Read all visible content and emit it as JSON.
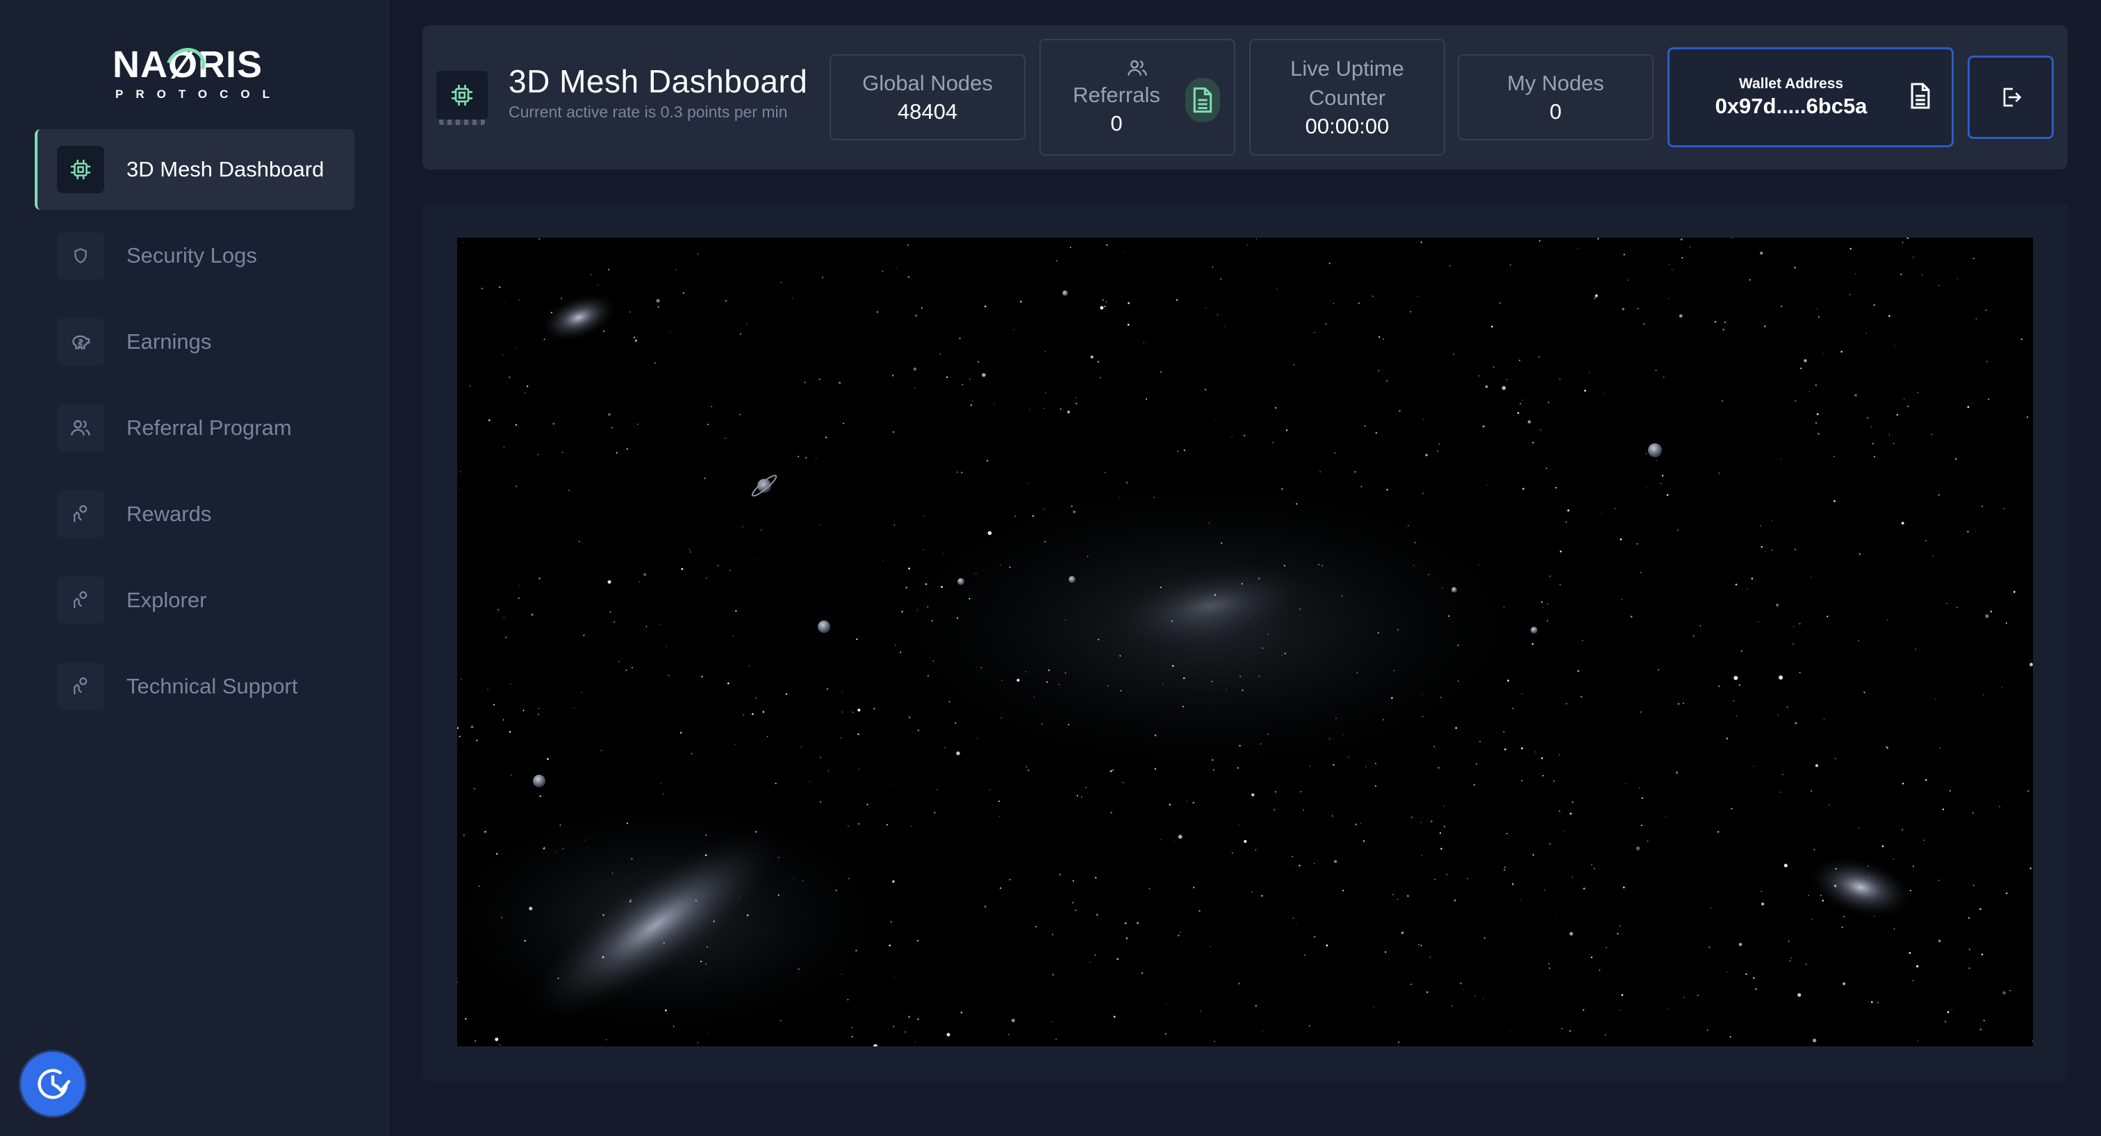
{
  "brand": {
    "logo_word_left": "NA",
    "logo_word_mark": "Ø",
    "logo_word_right": "RIS",
    "logo_sub": "PROTOCOL",
    "accent_color": "#7fe0b0",
    "primary_blue": "#2e5bc5"
  },
  "sidebar": {
    "items": [
      {
        "label": "3D Mesh Dashboard",
        "icon": "chip-icon",
        "active": true
      },
      {
        "label": "Security Logs",
        "icon": "shield-icon",
        "active": false
      },
      {
        "label": "Earnings",
        "icon": "piggy-bank-icon",
        "active": false
      },
      {
        "label": "Referral Program",
        "icon": "users-icon",
        "active": false
      },
      {
        "label": "Rewards",
        "icon": "hand-coin-icon",
        "active": false
      },
      {
        "label": "Explorer",
        "icon": "hand-coin-icon",
        "active": false
      },
      {
        "label": "Technical Support",
        "icon": "hand-coin-icon",
        "active": false
      }
    ]
  },
  "header": {
    "title": "3D Mesh Dashboard",
    "subtitle": "Current active rate is 0.3 points per min",
    "global_nodes": {
      "label": "Global Nodes",
      "value": "48404"
    },
    "referrals": {
      "label": "Referrals",
      "value": "0"
    },
    "uptime": {
      "label_line1": "Live Uptime",
      "label_line2": "Counter",
      "value": "00:00:00"
    },
    "my_nodes": {
      "label": "My Nodes",
      "value": "0"
    },
    "wallet": {
      "label": "Wallet Address",
      "value": "0x97d.....6bc5a"
    }
  },
  "main": {
    "view": "space-starfield"
  }
}
